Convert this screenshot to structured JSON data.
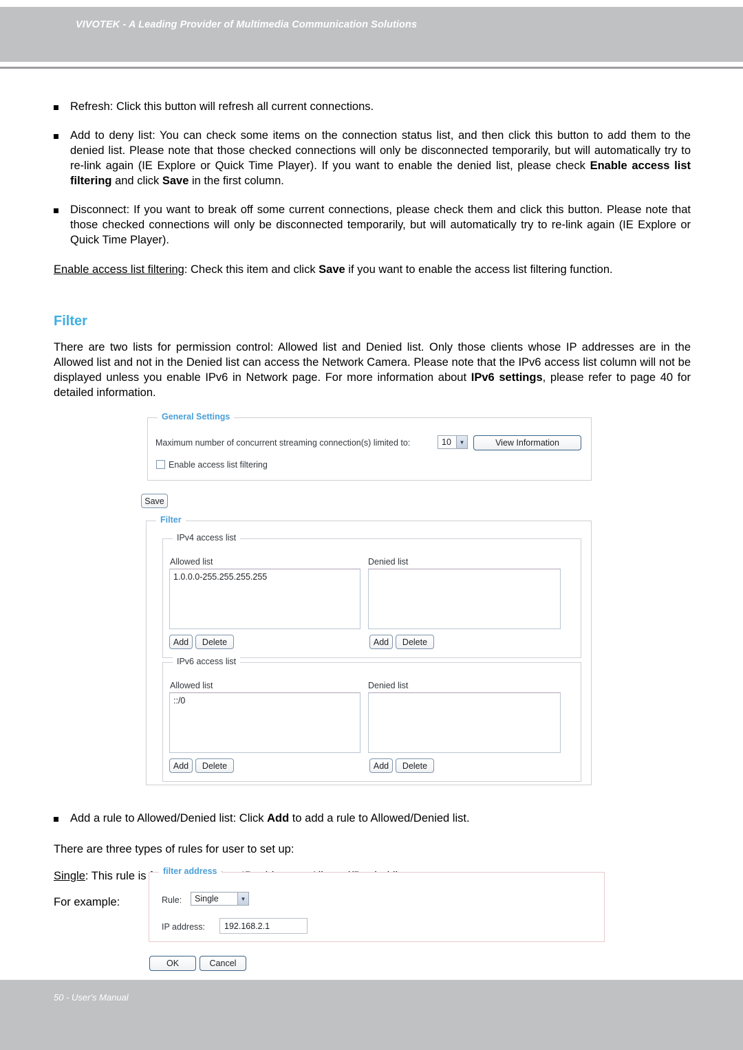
{
  "header": {
    "title": "VIVOTEK - A Leading Provider of Multimedia Communication Solutions"
  },
  "footer": {
    "text": "50 - User's Manual"
  },
  "body": {
    "bullet_refresh_text": "Refresh: Click this button will refresh all current connections.",
    "bullet_add_deny_p1": "Add to deny list: You can check some items on the connection status list, and then click this button to add them to the denied list. Please note that those checked connections will only be disconnected temporarily, but will automatically try to re-link again (IE Explore or Quick Time Player). If you want to enable the denied list, please check ",
    "bullet_add_deny_bold1": "Enable access list filtering",
    "bullet_add_deny_mid": " and click ",
    "bullet_add_deny_bold2": "Save",
    "bullet_add_deny_end": " in the first column.",
    "bullet_disconnect_text": "Disconnect: If you want to break off some current connections, please check them and click this button. Please note that those checked connections will only be disconnected temporarily, but will automatically try to re-link again (IE Explore or Quick Time Player).",
    "enable_filtering_underlined": "Enable access list filtering",
    "enable_filtering_mid": ": Check this item and click ",
    "enable_filtering_bold": "Save",
    "enable_filtering_end": " if you want to enable the access list filtering function.",
    "section_title": "Filter",
    "filter_para_start": "There are two lists for permission control: Allowed list and Denied list. Only those clients whose IP addresses are in the Allowed list and not in the Denied list can access the Network Camera. Please note that the IPv6 access list column will not be displayed unless you enable IPv6 in Network page. For more information about ",
    "filter_para_bold": "IPv6 settings",
    "filter_para_end": ", please refer to page 40 for detailed information.",
    "bullet_add_rule_start": "Add a rule to Allowed/Denied list: Click ",
    "bullet_add_rule_bold": "Add",
    "bullet_add_rule_end": " to add a rule to Allowed/Denied list.",
    "three_types_line": "There are three types of rules for user to set up:",
    "single_underlined": "Single",
    "single_rest": ": This rule is for user to add an IP address to Allowed/Denied list.",
    "for_example_line": "For example:"
  },
  "general_settings": {
    "legend": "General Settings",
    "max_conn_label": "Maximum number of concurrent streaming connection(s) limited to:",
    "max_conn_value": "10",
    "dropdown_arrow_icon": "chevron-down-icon",
    "view_information_button": "View Information",
    "enable_filtering_checkbox_label": "Enable access list filtering",
    "enable_filtering_checked": false,
    "save_button": "Save"
  },
  "filter_panel": {
    "legend": "Filter",
    "ipv4": {
      "legend": "IPv4 access list",
      "allowed_label": "Allowed list",
      "denied_label": "Denied list",
      "allowed_values": "1.0.0.0-255.255.255.255",
      "denied_values": "",
      "add_button": "Add",
      "delete_button": "Delete"
    },
    "ipv6": {
      "legend": "IPv6 access list",
      "allowed_label": "Allowed list",
      "denied_label": "Denied list",
      "allowed_values": "::/0",
      "denied_values": "",
      "add_button": "Add",
      "delete_button": "Delete"
    }
  },
  "filter_address_panel": {
    "legend": "filter address",
    "rule_label": "Rule:",
    "rule_value": "Single",
    "rule_arrow_icon": "chevron-down-icon",
    "ip_label": "IP address:",
    "ip_value": "192.168.2.1",
    "ok_button": "OK",
    "cancel_button": "Cancel"
  },
  "colors": {
    "header_gray": "#c0c1c2",
    "accent_blue": "#3eafe3",
    "legend_blue": "#4a9fd8",
    "pink_border": "#e8c9cd"
  }
}
